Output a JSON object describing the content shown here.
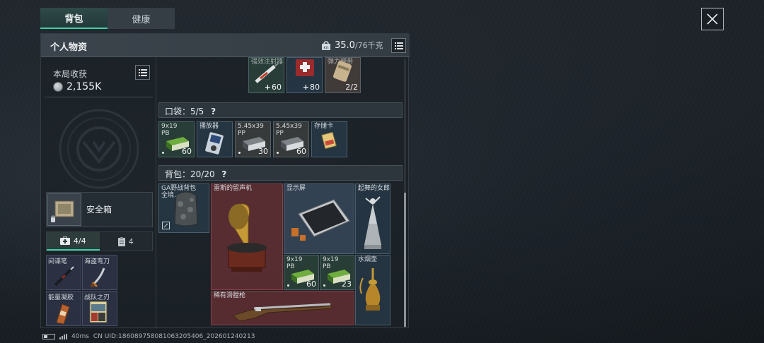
{
  "tabs": [
    {
      "label": "背包",
      "active": true
    },
    {
      "label": "健康",
      "active": false
    }
  ],
  "panel": {
    "title": "个人物资",
    "weight_current": "35.0",
    "weight_max": "/76千克"
  },
  "income": {
    "label": "本局收获",
    "value": "2,155K"
  },
  "safebox": {
    "label": "安全箱"
  },
  "subtabs": [
    {
      "label": "4/4",
      "icon": "medkit-icon",
      "active": true
    },
    {
      "label": "4",
      "icon": "clipboard-icon",
      "active": false
    }
  ],
  "safe_items": [
    {
      "name": "间谍笔",
      "icon": "pen-icon"
    },
    {
      "name": "海盗弯刀",
      "icon": "cutlass-icon"
    },
    {
      "name": "能量凝胶",
      "icon": "gel-pack-icon"
    },
    {
      "name": "战队之刃",
      "icon": "magazine-icon"
    }
  ],
  "top_items": [
    {
      "name": "强效注射器",
      "count": "60",
      "icon": "syringe-icon"
    },
    {
      "name": "",
      "count": "80",
      "icon": "first-aid-kit-icon"
    },
    {
      "name": "弹力绷带",
      "count": "2/2",
      "icon": "bandage-icon"
    }
  ],
  "pocket": {
    "label": "口袋：5/5",
    "help": "?",
    "items": [
      {
        "name": "9x19\nPB",
        "count": "60",
        "icon": "ammo-box-icon"
      },
      {
        "name": "播放器",
        "count": "",
        "icon": "media-player-icon"
      },
      {
        "name": "5.45x39\nPP",
        "count": "30",
        "icon": "ammo-box-icon"
      },
      {
        "name": "5.45x39\nPP",
        "count": "60",
        "icon": "ammo-box-icon"
      },
      {
        "name": "存储卡",
        "count": "",
        "icon": "memory-card-icon"
      }
    ]
  },
  "backpack": {
    "label": "背包：20/20",
    "help": "?",
    "bag_item": {
      "name": "GA野战背包\n全境…",
      "icon": "backpack-icon"
    },
    "items": [
      {
        "name": "雷斯的留声机",
        "icon": "gramophone-icon"
      },
      {
        "name": "显示屏",
        "icon": "display-screen-icon"
      },
      {
        "name": "起舞的女郎",
        "icon": "dancer-statue-icon"
      },
      {
        "name": "9x19\nPB",
        "count": "60",
        "icon": "ammo-box-icon"
      },
      {
        "name": "9x19\nPB",
        "count": "23",
        "icon": "ammo-box-icon"
      },
      {
        "name": "水烟壶",
        "icon": "hookah-icon"
      },
      {
        "name": "稀有滑膛枪",
        "icon": "musket-icon"
      }
    ]
  },
  "footer": {
    "ping": "40ms",
    "uid": "CN UID:18608975808106320540​6_202601240213"
  },
  "colors": {
    "accent": "#3fd0a8",
    "cell": "#28394a",
    "rare_red": "#703236"
  }
}
